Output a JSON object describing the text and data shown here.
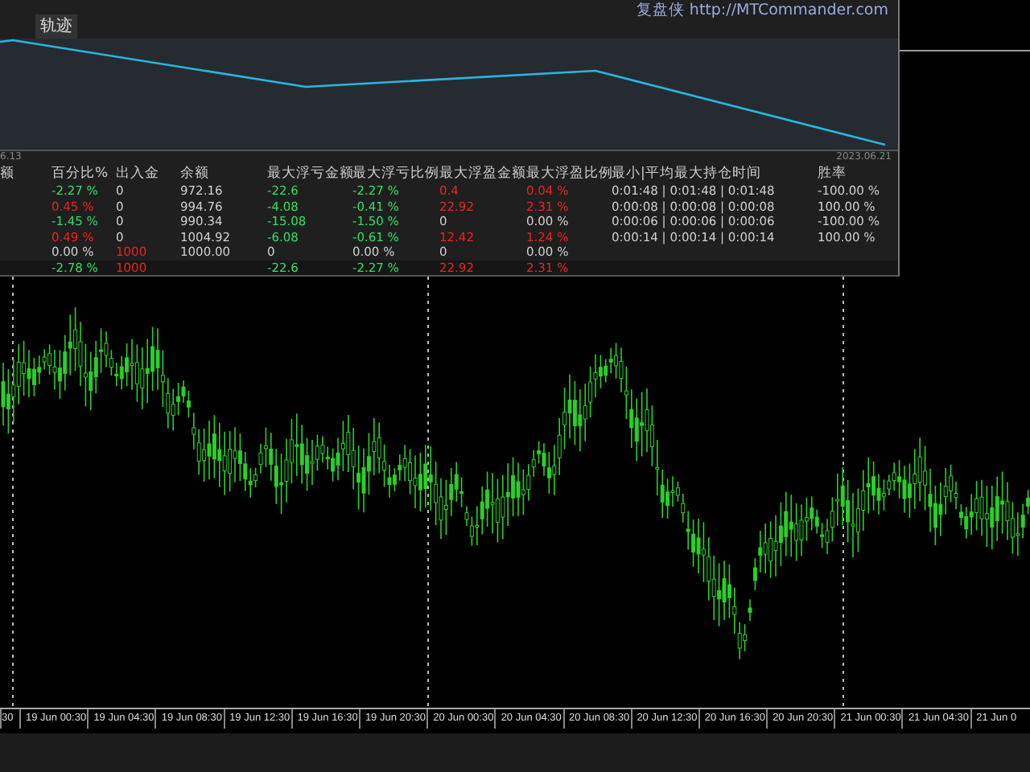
{
  "panel": {
    "title": "复盘侠 http://MTCommander.com",
    "tabs": [
      {
        "label": "轨迹",
        "selected": true
      }
    ],
    "start_date": "6.13",
    "end_date": "2023.06.21",
    "columns": [
      "额",
      "百分比%",
      "出入金",
      "余额",
      "最大浮亏金额",
      "最大浮亏比例",
      "最大浮盈金额",
      "最大浮盈比例",
      "最小|平均最大持仓时间",
      "胜率"
    ],
    "rows": [
      {
        "cells": [
          null,
          {
            "text": "-2.27 %",
            "color": "#33dd66"
          },
          {
            "text": "0",
            "color": "#d0d0d0"
          },
          {
            "text": "972.16",
            "color": "#d0d0d0"
          },
          {
            "text": "-22.6",
            "color": "#33dd66"
          },
          {
            "text": "-2.27 %",
            "color": "#33dd66"
          },
          {
            "text": "0.4",
            "color": "#ee2222"
          },
          {
            "text": "0.04 %",
            "color": "#ee2222"
          },
          {
            "text": "0:01:48 | 0:01:48 | 0:01:48",
            "color": "#d0d0d0"
          },
          {
            "text": "-100.00 %",
            "color": "#d0d0d0"
          }
        ]
      },
      {
        "cells": [
          null,
          {
            "text": "0.45 %",
            "color": "#ee2222"
          },
          {
            "text": "0",
            "color": "#d0d0d0"
          },
          {
            "text": "994.76",
            "color": "#d0d0d0"
          },
          {
            "text": "-4.08",
            "color": "#33dd66"
          },
          {
            "text": "-0.41 %",
            "color": "#33dd66"
          },
          {
            "text": "22.92",
            "color": "#ee2222"
          },
          {
            "text": "2.31 %",
            "color": "#ee2222"
          },
          {
            "text": "0:00:08 | 0:00:08 | 0:00:08",
            "color": "#d0d0d0"
          },
          {
            "text": "100.00 %",
            "color": "#d0d0d0"
          }
        ]
      },
      {
        "cells": [
          null,
          {
            "text": "-1.45 %",
            "color": "#33dd66"
          },
          {
            "text": "0",
            "color": "#d0d0d0"
          },
          {
            "text": "990.34",
            "color": "#d0d0d0"
          },
          {
            "text": "-15.08",
            "color": "#33dd66"
          },
          {
            "text": "-1.50 %",
            "color": "#33dd66"
          },
          {
            "text": "0",
            "color": "#d0d0d0"
          },
          {
            "text": "0.00 %",
            "color": "#d0d0d0"
          },
          {
            "text": "0:00:06 | 0:00:06 | 0:00:06",
            "color": "#d0d0d0"
          },
          {
            "text": "-100.00 %",
            "color": "#d0d0d0"
          }
        ]
      },
      {
        "cells": [
          null,
          {
            "text": "0.49 %",
            "color": "#ee2222"
          },
          {
            "text": "0",
            "color": "#d0d0d0"
          },
          {
            "text": "1004.92",
            "color": "#d0d0d0"
          },
          {
            "text": "-6.08",
            "color": "#33dd66"
          },
          {
            "text": "-0.61 %",
            "color": "#33dd66"
          },
          {
            "text": "12.42",
            "color": "#ee2222"
          },
          {
            "text": "1.24 %",
            "color": "#ee2222"
          },
          {
            "text": "0:00:14 | 0:00:14 | 0:00:14",
            "color": "#d0d0d0"
          },
          {
            "text": "100.00 %",
            "color": "#d0d0d0"
          }
        ]
      },
      {
        "cells": [
          null,
          {
            "text": "0.00 %",
            "color": "#d0d0d0"
          },
          {
            "text": "1000",
            "color": "#ee2222"
          },
          {
            "text": "1000.00",
            "color": "#d0d0d0"
          },
          {
            "text": "0",
            "color": "#d0d0d0"
          },
          {
            "text": "0.00 %",
            "color": "#d0d0d0"
          },
          {
            "text": "0",
            "color": "#d0d0d0"
          },
          {
            "text": "0.00 %",
            "color": "#d0d0d0"
          },
          null,
          null
        ]
      }
    ],
    "totals": {
      "cells": [
        null,
        {
          "text": "-2.78 %",
          "color": "#33dd66"
        },
        {
          "text": "1000",
          "color": "#ee2222"
        },
        null,
        {
          "text": "-22.6",
          "color": "#33dd66"
        },
        {
          "text": "-2.27 %",
          "color": "#33dd66"
        },
        {
          "text": "22.92",
          "color": "#ee2222"
        },
        {
          "text": "2.31 %",
          "color": "#ee2222"
        },
        null,
        null
      ]
    }
  },
  "time_axis": [
    "30",
    "19 Jun 00:30",
    "19 Jun 04:30",
    "19 Jun 08:30",
    "19 Jun 12:30",
    "19 Jun 16:30",
    "19 Jun 20:30",
    "20 Jun 00:30",
    "20 Jun 04:30",
    "20 Jun 08:30",
    "20 Jun 12:30",
    "20 Jun 16:30",
    "20 Jun 20:30",
    "21 Jun 00:30",
    "21 Jun 04:30",
    "21 Jun 0"
  ]
}
